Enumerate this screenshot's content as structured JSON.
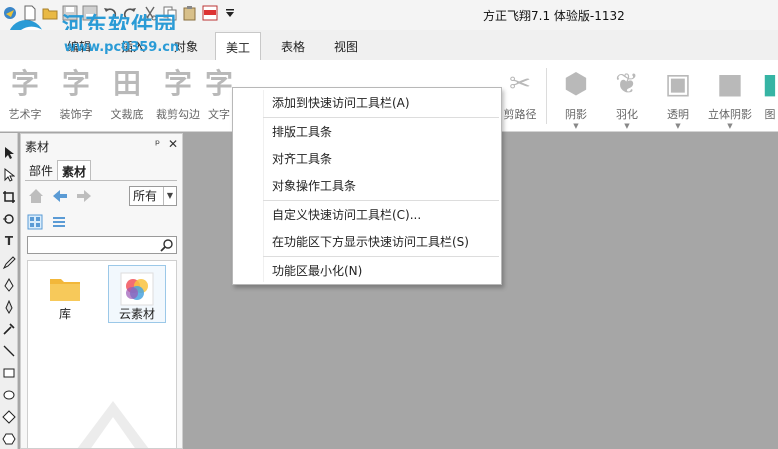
{
  "window": {
    "title": "方正飞翔7.1 体验版-1132",
    "watermark": "河东软件园",
    "watermark_url": "www.pc0359.cn"
  },
  "quick_access": [
    "new-file-icon",
    "open-folder-icon",
    "save-icon",
    "save-as-icon",
    "undo-icon",
    "redo-icon",
    "cut-icon",
    "copy-icon",
    "paste-icon",
    "pdf-export-icon",
    "dropdown-icon"
  ],
  "tabs": [
    {
      "label": "编辑"
    },
    {
      "label": "插入"
    },
    {
      "label": "对象"
    },
    {
      "label": "美工",
      "active": true
    },
    {
      "label": "表格"
    },
    {
      "label": "视图"
    }
  ],
  "ribbon": {
    "items": [
      {
        "label": "艺术字",
        "glyph": "字"
      },
      {
        "label": "装饰字",
        "glyph": "字"
      },
      {
        "label": "文裁底",
        "glyph": "田"
      },
      {
        "label": "裁剪勾边",
        "glyph": "字"
      },
      {
        "label": "文字",
        "glyph": "字"
      },
      {
        "label": "剪路径",
        "glyph": "✂"
      },
      {
        "label": "阴影",
        "glyph": "⬢"
      },
      {
        "label": "羽化",
        "glyph": "❦"
      },
      {
        "label": "透明",
        "glyph": "▣"
      },
      {
        "label": "立体阴影",
        "glyph": "■"
      },
      {
        "label": "图",
        "glyph": "▮"
      }
    ]
  },
  "context_menu": {
    "items": [
      "添加到快速访问工具栏(A)",
      "排版工具条",
      "对齐工具条",
      "对象操作工具条",
      "自定义快速访问工具栏(C)...",
      "在功能区下方显示快速访问工具栏(S)",
      "功能区最小化(N)"
    ]
  },
  "panel": {
    "title": "素材",
    "pin": "ᵖ",
    "close": "✕",
    "tabs": [
      {
        "label": "部件"
      },
      {
        "label": "素材",
        "active": true
      }
    ],
    "filter": "所有",
    "search_value": "",
    "tiles": [
      {
        "label": "库",
        "icon": "folder-icon"
      },
      {
        "label": "云素材",
        "icon": "cloud-material-icon",
        "selected": true
      }
    ]
  },
  "toolbox": [
    "select-arrow-icon",
    "direct-select-icon",
    "crop-icon",
    "rotate-icon",
    "text-tool-icon",
    "pencil-icon",
    "pen-icon",
    "brush-icon",
    "eyedropper-icon",
    "line-icon",
    "rectangle-icon",
    "ellipse-icon",
    "diamond-icon",
    "polygon-icon"
  ],
  "colors": {
    "accent": "#2a9bd6",
    "canvas": "#a6a6a6",
    "folder": "#f2b73a"
  }
}
